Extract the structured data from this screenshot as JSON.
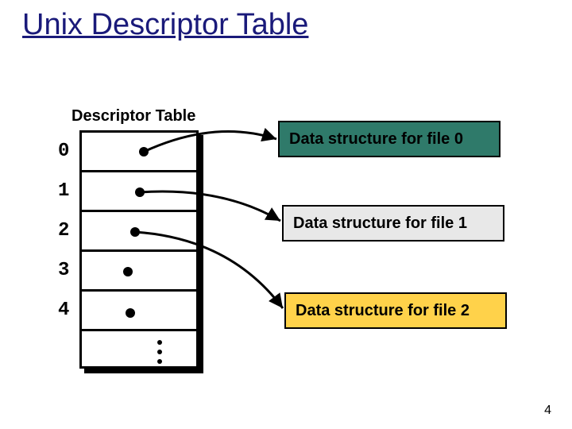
{
  "title": "Unix Descriptor Table",
  "table_label": "Descriptor Table",
  "rows": [
    "0",
    "1",
    "2",
    "3",
    "4"
  ],
  "data_structures": {
    "ds0": "Data structure for file 0",
    "ds1": "Data structure for file 1",
    "ds2": "Data structure for file 2"
  },
  "slide_number": "4",
  "chart_data": {
    "type": "table",
    "title": "Unix Descriptor Table",
    "descriptor_table_indices": [
      0,
      1,
      2,
      3,
      4
    ],
    "pointers": [
      {
        "index": 0,
        "target": "Data structure for file 0"
      },
      {
        "index": 1,
        "target": "Data structure for file 1"
      },
      {
        "index": 2,
        "target": "Data structure for file 2"
      },
      {
        "index": 3,
        "target": null
      },
      {
        "index": 4,
        "target": null
      }
    ]
  }
}
